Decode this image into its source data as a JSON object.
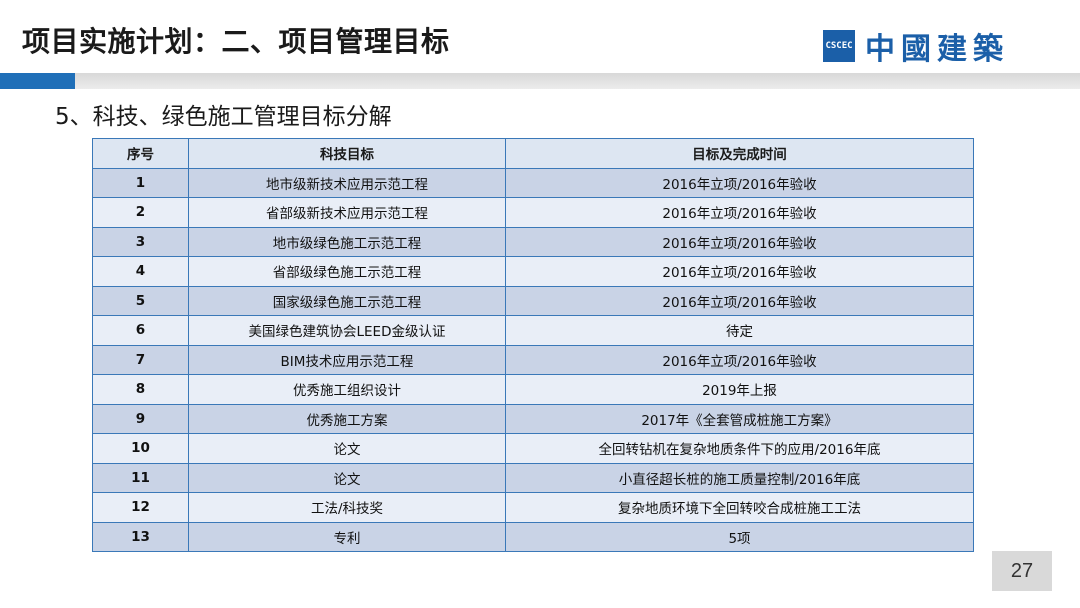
{
  "slide": {
    "title": "项目实施计划：二、项目管理目标",
    "subtitle": "5、科技、绿色施工管理目标分解",
    "page_number": "27"
  },
  "logo": {
    "mark_text": "CSCEC",
    "brand_text": "中國建築",
    "brand_color": "#1b5fa8"
  },
  "table": {
    "headers": [
      "序号",
      "科技目标",
      "目标及完成时间"
    ],
    "rows": [
      {
        "no": "1",
        "goal": "地市级新技术应用示范工程",
        "target": "2016年立项/2016年验收"
      },
      {
        "no": "2",
        "goal": "省部级新技术应用示范工程",
        "target": "2016年立项/2016年验收"
      },
      {
        "no": "3",
        "goal": "地市级绿色施工示范工程",
        "target": "2016年立项/2016年验收"
      },
      {
        "no": "4",
        "goal": "省部级绿色施工示范工程",
        "target": "2016年立项/2016年验收"
      },
      {
        "no": "5",
        "goal": "国家级绿色施工示范工程",
        "target": "2016年立项/2016年验收"
      },
      {
        "no": "6",
        "goal": "美国绿色建筑协会LEED金级认证",
        "target": "待定"
      },
      {
        "no": "7",
        "goal": "BIM技术应用示范工程",
        "target": "2016年立项/2016年验收"
      },
      {
        "no": "8",
        "goal": "优秀施工组织设计",
        "target": "2019年上报"
      },
      {
        "no": "9",
        "goal": "优秀施工方案",
        "target": "2017年《全套管成桩施工方案》"
      },
      {
        "no": "10",
        "goal": "论文",
        "target": "全回转钻机在复杂地质条件下的应用/2016年底"
      },
      {
        "no": "11",
        "goal": "论文",
        "target": "小直径超长桩的施工质量控制/2016年底"
      },
      {
        "no": "12",
        "goal": "工法/科技奖",
        "target": "复杂地质环境下全回转咬合成桩施工工法"
      },
      {
        "no": "13",
        "goal": "专利",
        "target": "5项"
      }
    ]
  }
}
